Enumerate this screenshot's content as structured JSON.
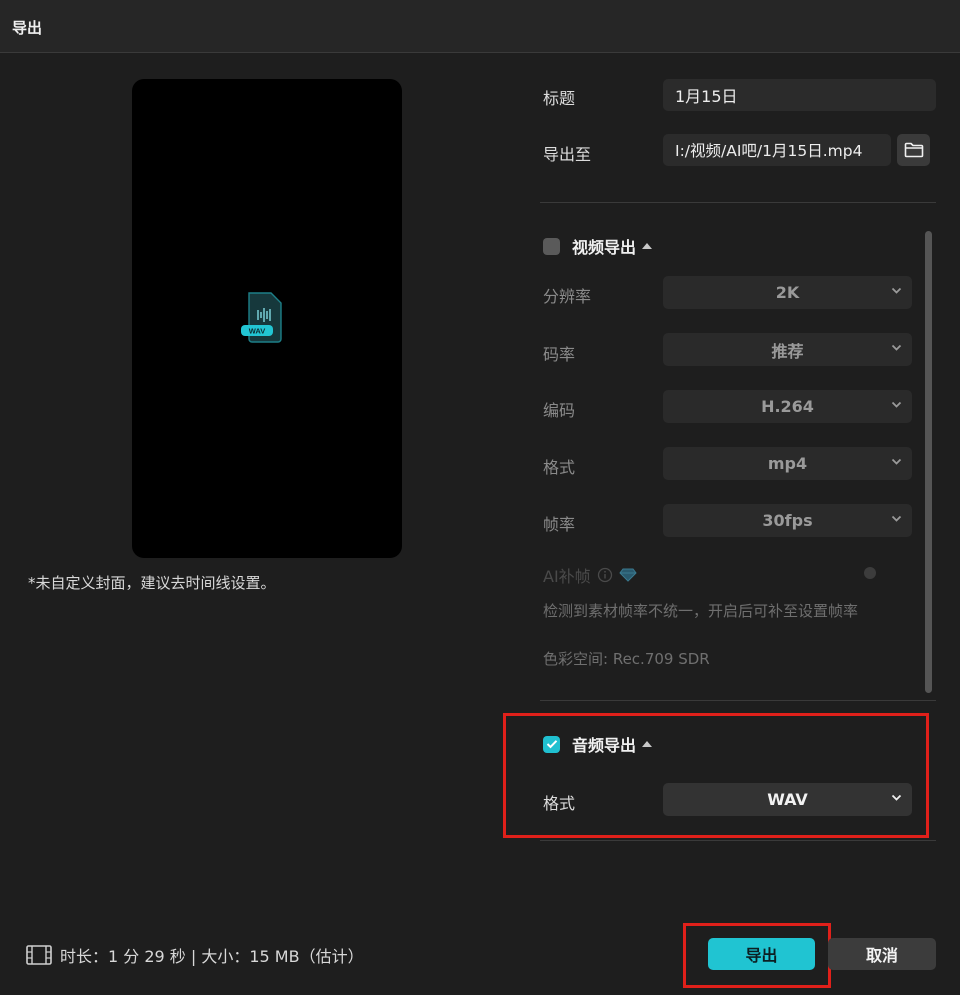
{
  "window": {
    "title": "导出"
  },
  "preview": {
    "file_badge": "WAV",
    "note": "*未自定义封面，建议去时间线设置。"
  },
  "fields": {
    "title_label": "标题",
    "title_value": "1月15日",
    "export_to_label": "导出至",
    "export_path": "I:/视频/AI吧/1月15日.mp4"
  },
  "video_export": {
    "checked": false,
    "title": "视频导出",
    "settings": [
      {
        "label": "分辨率",
        "value": "2K"
      },
      {
        "label": "码率",
        "value": "推荐"
      },
      {
        "label": "编码",
        "value": "H.264"
      },
      {
        "label": "格式",
        "value": "mp4"
      },
      {
        "label": "帧率",
        "value": "30fps"
      }
    ],
    "ai_frame_label": "AI补帧",
    "ai_hint": "检测到素材帧率不统一，开启后可补至设置帧率",
    "color_space": "色彩空间:  Rec.709 SDR"
  },
  "audio_export": {
    "checked": true,
    "title": "音频导出",
    "format_label": "格式",
    "format_value": "WAV"
  },
  "footer": {
    "info": "时长：1 分 29 秒 | 大小：15 MB（估计）"
  },
  "buttons": {
    "export": "导出",
    "cancel": "取消"
  },
  "colors": {
    "accent": "#20c4d2",
    "highlight_box": "#e0201a",
    "background": "#1e1e1e"
  }
}
